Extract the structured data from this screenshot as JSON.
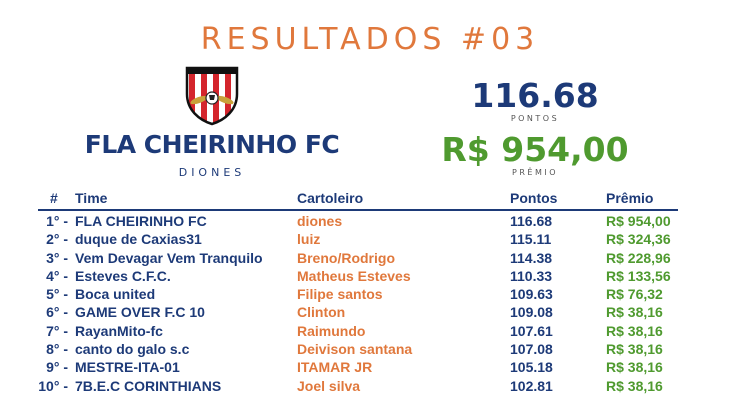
{
  "header": {
    "title": "RESULTADOS #03"
  },
  "team": {
    "name": "FLA CHEIRINHO FC",
    "owner": "DIONES",
    "points": "116.68",
    "points_label": "PONTOS",
    "prize": "R$ 954,00",
    "prize_label": "PRÊMIO"
  },
  "colors": {
    "accent_orange": "#e0783c",
    "navy": "#1d3a78",
    "green": "#4f9a2f"
  },
  "table": {
    "columns": [
      "#",
      "Time",
      "Cartoleiro",
      "Pontos",
      "Prêmio"
    ],
    "rows": [
      {
        "pos": "1° -",
        "team": "FLA CHEIRINHO FC",
        "cartoleiro": "diones",
        "points": "116.68",
        "prize": "R$ 954,00"
      },
      {
        "pos": "2° -",
        "team": "duque de Caxias31",
        "cartoleiro": "luiz",
        "points": "115.11",
        "prize": "R$ 324,36"
      },
      {
        "pos": "3° -",
        "team": "Vem Devagar Vem Tranquilo",
        "cartoleiro": "Breno/Rodrigo",
        "points": "114.38",
        "prize": "R$ 228,96"
      },
      {
        "pos": "4° -",
        "team": "Esteves C.F.C.",
        "cartoleiro": "Matheus Esteves",
        "points": "110.33",
        "prize": "R$ 133,56"
      },
      {
        "pos": "5° -",
        "team": "Boca united",
        "cartoleiro": "Filipe santos",
        "points": "109.63",
        "prize": "R$ 76,32"
      },
      {
        "pos": "6° -",
        "team": "GAME OVER F.C 10",
        "cartoleiro": "Clinton",
        "points": "109.08",
        "prize": "R$ 38,16"
      },
      {
        "pos": "7° -",
        "team": "RayanMito-fc",
        "cartoleiro": "Raimundo",
        "points": "107.61",
        "prize": "R$ 38,16"
      },
      {
        "pos": "8° -",
        "team": "canto do galo s.c",
        "cartoleiro": "Deivison santana",
        "points": "107.08",
        "prize": "R$ 38,16"
      },
      {
        "pos": "9° -",
        "team": "MESTRE-ITA-01",
        "cartoleiro": "ITAMAR JR",
        "points": "105.18",
        "prize": "R$ 38,16"
      },
      {
        "pos": "10° -",
        "team": "7B.E.C CORINTHIANS",
        "cartoleiro": "Joel silva",
        "points": "102.81",
        "prize": "R$ 38,16"
      }
    ]
  }
}
